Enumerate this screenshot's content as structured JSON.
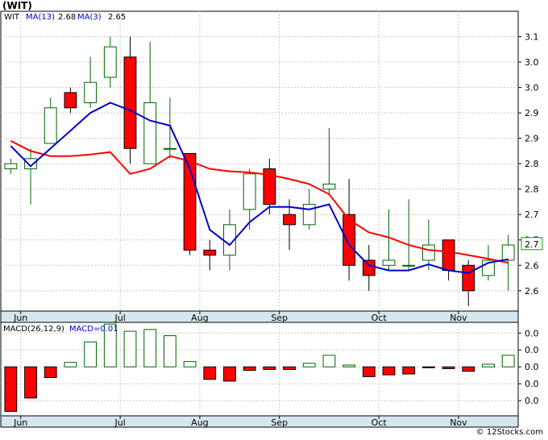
{
  "title": "(WIT)",
  "watermark": "© 12Stocks.com",
  "legend": {
    "ticker": "WIT",
    "ma13_label": "MA(13)",
    "ma13_value": "2.68",
    "ma3_label": "MA(3)",
    "ma3_value": "2.65"
  },
  "macd_legend": {
    "label": "MACD(26,12,9)",
    "value_label": "MACD=0.01"
  },
  "colors": {
    "up_candle_fill": "#ffffff",
    "up_candle_stroke": "#006400",
    "down_candle_fill": "#ff0000",
    "ma13": "#ff0000",
    "ma3": "#0000cc",
    "month_band": "#d5e6ee",
    "grid": "#c8c8c8",
    "last_price_label": "#00aa00"
  },
  "last_price_label": "2.7",
  "chart_data": [
    {
      "type": "candlestick",
      "ylim": [
        2.56,
        3.15
      ],
      "y_ticks": [
        2.6,
        2.65,
        2.7,
        2.75,
        2.8,
        2.85,
        2.9,
        2.95,
        3.0,
        3.05,
        3.1
      ],
      "y_tick_labels": [
        "2.6",
        "2.6",
        "2.7",
        "2.7",
        "2.8",
        "2.8",
        "2.9",
        "2.9",
        "3.0",
        "3.0",
        "3.1"
      ],
      "x_labels": [
        {
          "label": "Jun",
          "index": 1
        },
        {
          "label": "Jul",
          "index": 6
        },
        {
          "label": "Aug",
          "index": 10
        },
        {
          "label": "Sep",
          "index": 14
        },
        {
          "label": "Oct",
          "index": 19
        },
        {
          "label": "Nov",
          "index": 23
        }
      ],
      "candles": [
        {
          "o": 2.84,
          "h": 2.86,
          "l": 2.83,
          "c": 2.85
        },
        {
          "o": 2.84,
          "h": 2.88,
          "l": 2.77,
          "c": 2.86
        },
        {
          "o": 2.89,
          "h": 2.98,
          "l": 2.89,
          "c": 2.96
        },
        {
          "o": 2.99,
          "h": 3.0,
          "l": 2.95,
          "c": 2.96
        },
        {
          "o": 2.97,
          "h": 3.06,
          "l": 2.96,
          "c": 3.01
        },
        {
          "o": 3.02,
          "h": 3.1,
          "l": 3.0,
          "c": 3.08
        },
        {
          "o": 3.06,
          "h": 3.1,
          "l": 2.85,
          "c": 2.88
        },
        {
          "o": 2.85,
          "h": 3.09,
          "l": 2.85,
          "c": 2.97
        },
        {
          "o": 2.88,
          "h": 2.98,
          "l": 2.86,
          "c": 2.88
        },
        {
          "o": 2.87,
          "h": 2.87,
          "l": 2.67,
          "c": 2.68
        },
        {
          "o": 2.68,
          "h": 2.7,
          "l": 2.64,
          "c": 2.67
        },
        {
          "o": 2.67,
          "h": 2.76,
          "l": 2.64,
          "c": 2.73
        },
        {
          "o": 2.76,
          "h": 2.84,
          "l": 2.72,
          "c": 2.83
        },
        {
          "o": 2.84,
          "h": 2.86,
          "l": 2.75,
          "c": 2.77
        },
        {
          "o": 2.75,
          "h": 2.78,
          "l": 2.68,
          "c": 2.73
        },
        {
          "o": 2.73,
          "h": 2.8,
          "l": 2.72,
          "c": 2.77
        },
        {
          "o": 2.8,
          "h": 2.92,
          "l": 2.79,
          "c": 2.81
        },
        {
          "o": 2.75,
          "h": 2.82,
          "l": 2.62,
          "c": 2.65
        },
        {
          "o": 2.66,
          "h": 2.69,
          "l": 2.6,
          "c": 2.63
        },
        {
          "o": 2.65,
          "h": 2.76,
          "l": 2.64,
          "c": 2.66
        },
        {
          "o": 2.65,
          "h": 2.78,
          "l": 2.64,
          "c": 2.65
        },
        {
          "o": 2.66,
          "h": 2.74,
          "l": 2.64,
          "c": 2.69
        },
        {
          "o": 2.7,
          "h": 2.7,
          "l": 2.62,
          "c": 2.64
        },
        {
          "o": 2.65,
          "h": 2.66,
          "l": 2.57,
          "c": 2.6
        },
        {
          "o": 2.63,
          "h": 2.69,
          "l": 2.62,
          "c": 2.66
        },
        {
          "o": 2.66,
          "h": 2.71,
          "l": 2.6,
          "c": 2.69
        }
      ],
      "series": [
        {
          "name": "MA(13)",
          "values": [
            2.88,
            2.86,
            2.855,
            null,
            null,
            null,
            null,
            null,
            null,
            2.9,
            2.88,
            2.86,
            2.86,
            2.845,
            2.83,
            2.815,
            2.78,
            2.735,
            2.705,
            2.68,
            2.665,
            2.66,
            2.655,
            2.66,
            2.655,
            2.66
          ]
        },
        {
          "name": "MA(3)",
          "values": [
            2.825,
            null,
            null,
            null,
            null,
            null,
            null,
            null,
            null,
            null,
            null,
            null,
            null,
            null,
            null,
            null,
            null,
            null,
            null,
            null,
            null,
            null,
            null,
            null,
            null,
            null
          ]
        }
      ]
    },
    {
      "type": "bar",
      "name": "MACD",
      "y_tick_labels": [
        "0.0",
        "0.0",
        "0.0",
        "0.0",
        "0.0"
      ],
      "x_labels": [
        {
          "label": "Jun",
          "index": 1
        },
        {
          "label": "Jul",
          "index": 6
        },
        {
          "label": "Aug",
          "index": 10
        },
        {
          "label": "Sep",
          "index": 14
        },
        {
          "label": "Oct",
          "index": 19
        },
        {
          "label": "Nov",
          "index": 23
        }
      ],
      "ylim": [
        -0.055,
        0.05
      ],
      "values": [
        -0.05,
        -0.035,
        -0.012,
        0.005,
        0.028,
        0.048,
        0.04,
        0.042,
        0.035,
        0.006,
        -0.014,
        -0.016,
        -0.004,
        -0.003,
        -0.003,
        0.004,
        0.013,
        0.002,
        -0.011,
        -0.009,
        -0.008,
        -0.001,
        -0.002,
        -0.005,
        0.003,
        0.013
      ]
    }
  ]
}
